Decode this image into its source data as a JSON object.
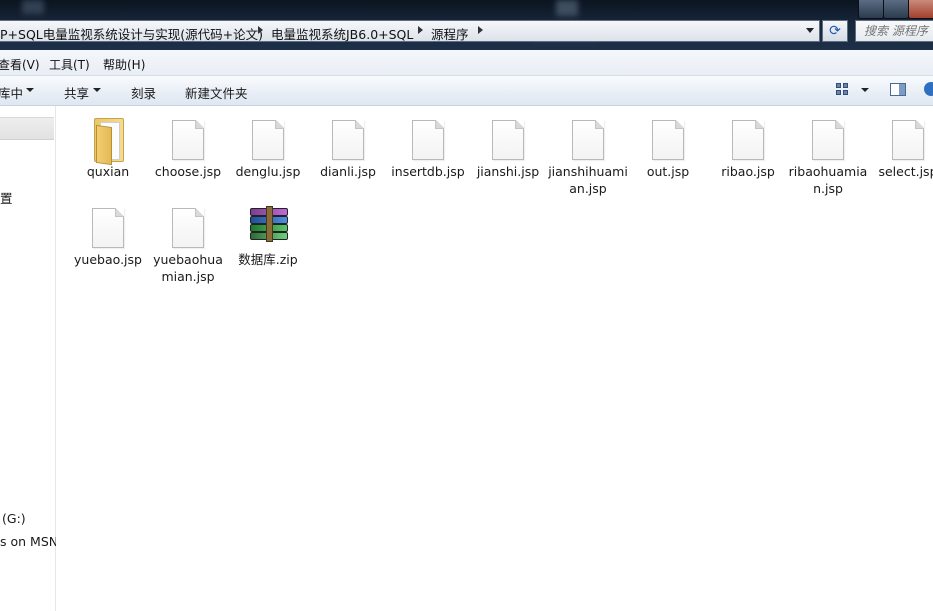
{
  "address_bar": {
    "crumbs": [
      "P+SQL电量监视系统设计与实现(源代码+论文)",
      "电量监视系统JB6.0+SQL",
      "源程序"
    ],
    "refresh_icon": "refresh-icon",
    "search_placeholder": "搜索 源程序"
  },
  "menu": {
    "view": "查看(V)",
    "tools": "工具(T)",
    "help": "帮助(H)"
  },
  "toolbar": {
    "include_in_library": "库中",
    "share": "共享",
    "burn": "刻录",
    "new_folder": "新建文件夹"
  },
  "nav": {
    "item_1": "置",
    "item_2": "(G:)",
    "item_3": "s on MSN"
  },
  "files": [
    {
      "name": "quxian",
      "kind": "folder"
    },
    {
      "name": "choose.jsp",
      "kind": "file"
    },
    {
      "name": "denglu.jsp",
      "kind": "file"
    },
    {
      "name": "dianli.jsp",
      "kind": "file"
    },
    {
      "name": "insertdb.jsp",
      "kind": "file"
    },
    {
      "name": "jianshi.jsp",
      "kind": "file"
    },
    {
      "name": "jianshihuamian.jsp",
      "kind": "file"
    },
    {
      "name": "out.jsp",
      "kind": "file"
    },
    {
      "name": "ribao.jsp",
      "kind": "file"
    },
    {
      "name": "ribaohuamian.jsp",
      "kind": "file"
    },
    {
      "name": "select.jsp",
      "kind": "file"
    },
    {
      "name": "yuebao.jsp",
      "kind": "file"
    },
    {
      "name": "yuebaohuamian.jsp",
      "kind": "file"
    },
    {
      "name": "数据库.zip",
      "kind": "zip"
    }
  ]
}
